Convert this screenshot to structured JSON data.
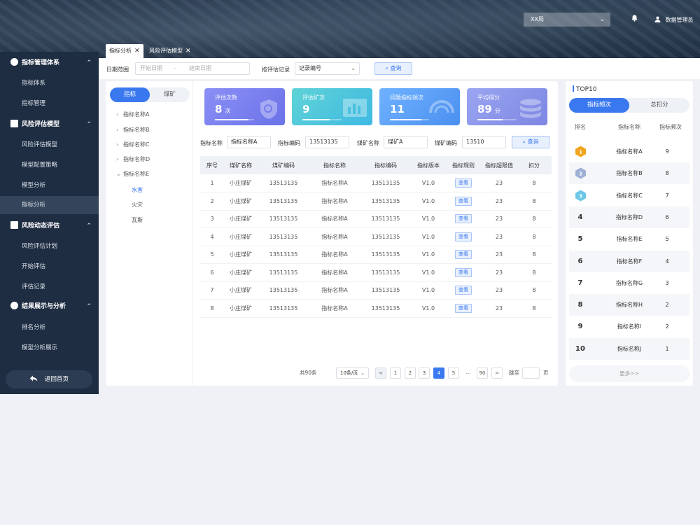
{
  "header": {
    "org_select": "XX局",
    "user_name": "数据管理员"
  },
  "sidebar": {
    "groups": [
      {
        "title": "指标管理体系",
        "items": [
          "指标体系",
          "指标管理"
        ]
      },
      {
        "title": "风险评估模型",
        "items": [
          "风险评估模型",
          "模型配置策略",
          "模型分析",
          "指标分析"
        ]
      },
      {
        "title": "风险动态评估",
        "items": [
          "风险评估计划",
          "开始评估",
          "评估记录"
        ]
      },
      {
        "title": "结果展示与分析",
        "items": [
          "排名分析",
          "模型分析展示"
        ]
      }
    ],
    "active_item": "指标分析",
    "back_label": "返回首页"
  },
  "tabs": [
    {
      "label": "指标分析"
    },
    {
      "label": "风险评估模型"
    }
  ],
  "filter": {
    "date_label": "日期范围",
    "start_placeholder": "开始日期",
    "range_sep": "-",
    "end_placeholder": "结束日期",
    "record_label": "按评估记录",
    "record_value": "记录编号",
    "query_label": "查询"
  },
  "tree": {
    "seg": [
      "指标",
      "煤矿"
    ],
    "nodes": [
      "指标名称A",
      "指标名称B",
      "指标名称C",
      "指标名称D",
      "指标名称E"
    ],
    "leaves": [
      "水害",
      "火灾",
      "瓦斯"
    ],
    "active_leaf": "水害"
  },
  "stats": [
    {
      "label": "评估次数",
      "value": "8",
      "unit": "次",
      "progress": 0.85,
      "color1": "#8a8ff5",
      "color2": "#6b72e8"
    },
    {
      "label": "评估矿次",
      "value": "9",
      "unit": "",
      "progress": 0.7,
      "color1": "#5fd3d6",
      "color2": "#3fb9e3"
    },
    {
      "label": "问题指标频次",
      "value": "11",
      "unit": "",
      "progress": 0.8,
      "color1": "#6fb2ff",
      "color2": "#4b8ff0"
    },
    {
      "label": "平均得分",
      "value": "89",
      "unit": "分",
      "progress": 0.65,
      "color1": "#9aa6f2",
      "color2": "#7d86e2"
    }
  ],
  "search": {
    "f1_label": "指标名称",
    "f1_value": "指标名称A",
    "f2_label": "指标编码",
    "f2_value": "13513135",
    "f3_label": "煤矿名称",
    "f3_value": "煤矿A",
    "f4_label": "煤矿编码",
    "f4_value": "13510",
    "query_label": "查询"
  },
  "table": {
    "columns": [
      "序号",
      "煤矿名称",
      "煤矿编码",
      "指标名称",
      "指标编码",
      "指标版本",
      "指标规则",
      "指标超限值",
      "扣分"
    ],
    "view_label": "查看",
    "rows": [
      [
        "1",
        "小庄煤矿",
        "13513135",
        "指标名称A",
        "13513135",
        "V1.0",
        "23",
        "8"
      ],
      [
        "2",
        "小庄煤矿",
        "13513135",
        "指标名称A",
        "13513135",
        "V1.0",
        "23",
        "8"
      ],
      [
        "3",
        "小庄煤矿",
        "13513135",
        "指标名称A",
        "13513135",
        "V1.0",
        "23",
        "8"
      ],
      [
        "4",
        "小庄煤矿",
        "13513135",
        "指标名称A",
        "13513135",
        "V1.0",
        "23",
        "8"
      ],
      [
        "5",
        "小庄煤矿",
        "13513135",
        "指标名称A",
        "13513135",
        "V1.0",
        "23",
        "8"
      ],
      [
        "6",
        "小庄煤矿",
        "13513135",
        "指标名称A",
        "13513135",
        "V1.0",
        "23",
        "8"
      ],
      [
        "7",
        "小庄煤矿",
        "13513135",
        "指标名称A",
        "13513135",
        "V1.0",
        "23",
        "8"
      ],
      [
        "8",
        "小庄煤矿",
        "13513135",
        "指标名称A",
        "13513135",
        "V1.0",
        "23",
        "8"
      ]
    ]
  },
  "pager": {
    "total": "共90条",
    "page_size": "10条/页",
    "prev": "<",
    "pages": [
      "1",
      "2",
      "3",
      "4",
      "5",
      "...",
      "90"
    ],
    "current": "4",
    "next": ">",
    "jump_label": "跳至",
    "jump_unit": "页"
  },
  "top10": {
    "title": "TOP10",
    "seg": [
      "指标频次",
      "总扣分"
    ],
    "head": [
      "排名",
      "指标名称",
      "指标频次"
    ],
    "rows": [
      {
        "rank": "1",
        "name": "指标名称A",
        "value": "9"
      },
      {
        "rank": "2",
        "name": "指标名称B",
        "value": "8"
      },
      {
        "rank": "3",
        "name": "指标名称C",
        "value": "7"
      },
      {
        "rank": "4",
        "name": "指标名称D",
        "value": "6"
      },
      {
        "rank": "5",
        "name": "指标名称E",
        "value": "5"
      },
      {
        "rank": "6",
        "name": "指标名称F",
        "value": "4"
      },
      {
        "rank": "7",
        "name": "指标名称G",
        "value": "3"
      },
      {
        "rank": "8",
        "name": "指标名称H",
        "value": "2"
      },
      {
        "rank": "9",
        "name": "指标名称I",
        "value": "2"
      },
      {
        "rank": "10",
        "name": "指标名称J",
        "value": "1"
      }
    ],
    "medal_colors": [
      "#f1a51f",
      "#9fb0d6",
      "#6cc7e6"
    ],
    "more_label": "更多>>"
  },
  "colors": {
    "accent": "#3a78ef",
    "sidebar": "#1e2d42"
  }
}
